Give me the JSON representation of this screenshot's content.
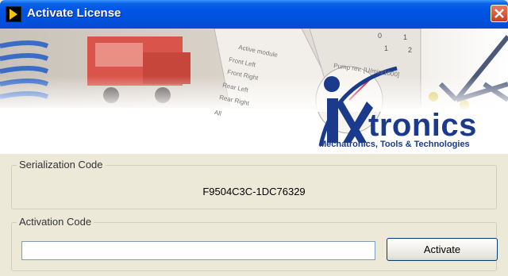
{
  "window": {
    "title": "Activate License",
    "icons": {
      "app": "play-triangle-icon",
      "close": "close-icon"
    }
  },
  "banner": {
    "logo_word": "tronics",
    "logo_tagline": "Mechatronics, Tools & Technologies",
    "module_title": "Active module",
    "module_options": [
      "Front Left",
      "Front Right",
      "Rear Left",
      "Rear Right",
      "All"
    ],
    "module_selected": "Rear Left",
    "gauge_label": "Pump rev. [U/min/1000]",
    "table_numbers": [
      "0",
      "1",
      "1",
      "2"
    ],
    "colors": {
      "logo_blue": "#1b3a8c"
    }
  },
  "serial": {
    "label": "Serialization Code",
    "value": "F9504C3C-1DC76329"
  },
  "activation": {
    "label": "Activation Code",
    "input_value": "",
    "button_label": "Activate"
  }
}
